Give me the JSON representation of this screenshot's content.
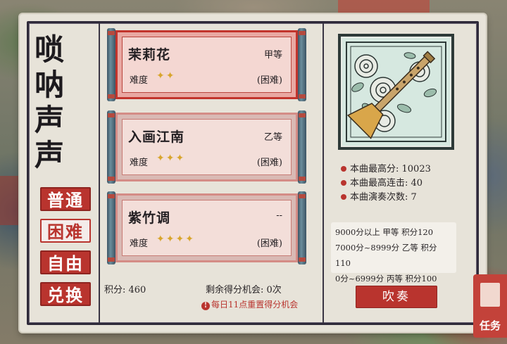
{
  "title": [
    "唢",
    "呐",
    "声",
    "声"
  ],
  "modes": [
    {
      "label": "普通",
      "active": false
    },
    {
      "label": "困难",
      "active": true
    },
    {
      "label": "自由",
      "active": false
    },
    {
      "label": "兑换",
      "active": false
    }
  ],
  "songs": [
    {
      "name": "茉莉花",
      "grade": "甲等",
      "difficulty_label": "难度",
      "stars": 2,
      "difficulty_text": "(困难)",
      "selected": true
    },
    {
      "name": "入画江南",
      "grade": "乙等",
      "difficulty_label": "难度",
      "stars": 3,
      "difficulty_text": "(困难)",
      "selected": false
    },
    {
      "name": "紫竹调",
      "grade": "--",
      "difficulty_label": "难度",
      "stars": 4,
      "difficulty_text": "(困难)",
      "selected": false
    }
  ],
  "footer": {
    "score": "积分: 460",
    "remaining": "剩余得分机会: 0次",
    "reset_note": "每日11点重置得分机会"
  },
  "stats": {
    "best_score": "本曲最高分: 10023",
    "best_combo": "本曲最高连击: 40",
    "play_count": "本曲演奏次数: 7"
  },
  "grade_rules": [
    "9000分以上 甲等 积分120",
    "7000分~8999分 乙等 积分110",
    "0分~6999分 丙等 积分100"
  ],
  "play_button": "吹奏",
  "task_button": "任务",
  "colors": {
    "accent_red": "#b9342e",
    "star_gold": "#d8a52c",
    "paper": "#e7e3d9"
  }
}
